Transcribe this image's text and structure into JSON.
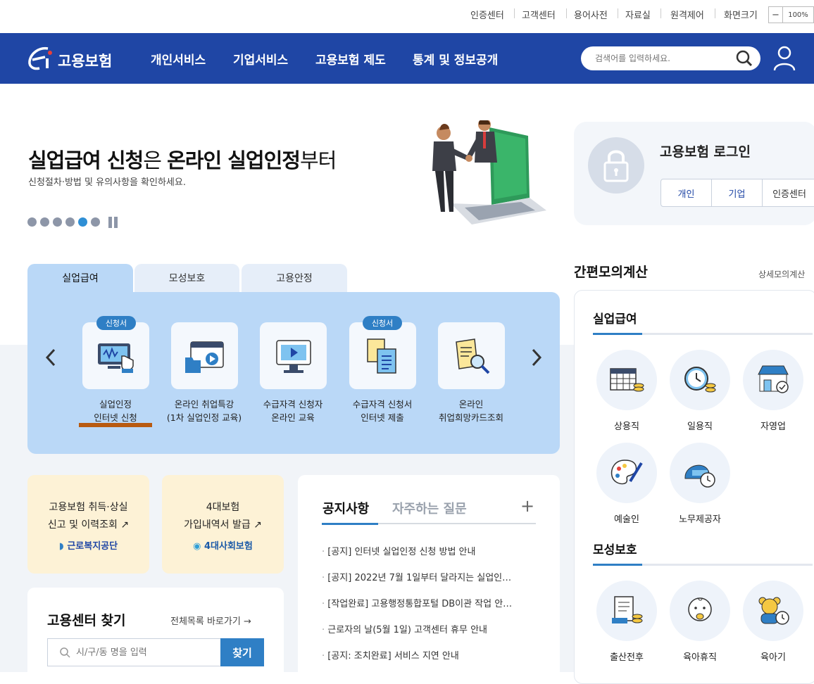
{
  "util_links": [
    "인증센터",
    "고객센터",
    "용어사전",
    "자료실",
    "원격제어",
    "화면크기"
  ],
  "zoom": {
    "minus": "−",
    "value": "100%"
  },
  "brand": {
    "logo_text": "고용보험"
  },
  "gnb": [
    "개인서비스",
    "기업서비스",
    "고용보험 제도",
    "통계 및 정보공개"
  ],
  "search": {
    "placeholder": "검색어를 입력하세요."
  },
  "hero": {
    "headline_a": "실업급여 신청",
    "headline_b": "은 ",
    "headline_c": "온라인 실업인정",
    "headline_d": "부터",
    "subtitle": "신청절차·방법 및 유의사항을 확인하세요."
  },
  "login": {
    "title": "고용보험 로그인",
    "buttons": [
      "개인",
      "기업",
      "인증센터"
    ]
  },
  "tabs": [
    "실업급여",
    "모성보호",
    "고용안정"
  ],
  "services": [
    {
      "label1": "실업인정",
      "label2": "인터넷 신청",
      "badge": "신청서"
    },
    {
      "label1": "온라인 취업특강",
      "label2": "(1차 실업인정 교육)",
      "badge": ""
    },
    {
      "label1": "수급자격 신청자",
      "label2": "온라인 교육",
      "badge": ""
    },
    {
      "label1": "수급자격 신청서",
      "label2": "인터넷 제출",
      "badge": "신청서"
    },
    {
      "label1": "온라인",
      "label2": "취업희망카드조회",
      "badge": ""
    }
  ],
  "cards": [
    {
      "line1": "고용보험 취득·상실",
      "line2": "신고 및 이력조회",
      "org": "근로복지공단"
    },
    {
      "line1": "4대보험",
      "line2": "가입내역서 발급",
      "org": "4대사회보험"
    }
  ],
  "notice": {
    "tab_active": "공지사항",
    "tab_other": "자주하는 질문",
    "more": "+",
    "items": [
      "[공지] 인터넷 실업인정 신청 방법 안내",
      "[공지] 2022년 7월 1일부터 달라지는 실업인…",
      "[작업완료] 고용행정통합포털 DB이관 작업 안…",
      "근로자의 날(5월 1일) 고객센터 휴무 안내",
      "[공지: 조치완료] 서비스 지연 안내"
    ]
  },
  "center": {
    "title": "고용센터 찾기",
    "link": "전체목록 바로가기",
    "arrow": "→",
    "placeholder": "시/구/동 명을 입력",
    "button": "찾기"
  },
  "calc": {
    "title": "간편모의계산",
    "detail": "상세모의계산",
    "sec1": "실업급여",
    "sec1_items": [
      "상용직",
      "일용직",
      "자영업",
      "예술인",
      "노무제공자"
    ],
    "sec2": "모성보호",
    "sec2_items": [
      "출산전후",
      "육아휴직",
      "육아기"
    ]
  },
  "colors": {
    "brand": "#1f46a5",
    "accent": "#2f7fc5",
    "panel": "#bad8f7",
    "card": "#fdf2d6"
  }
}
